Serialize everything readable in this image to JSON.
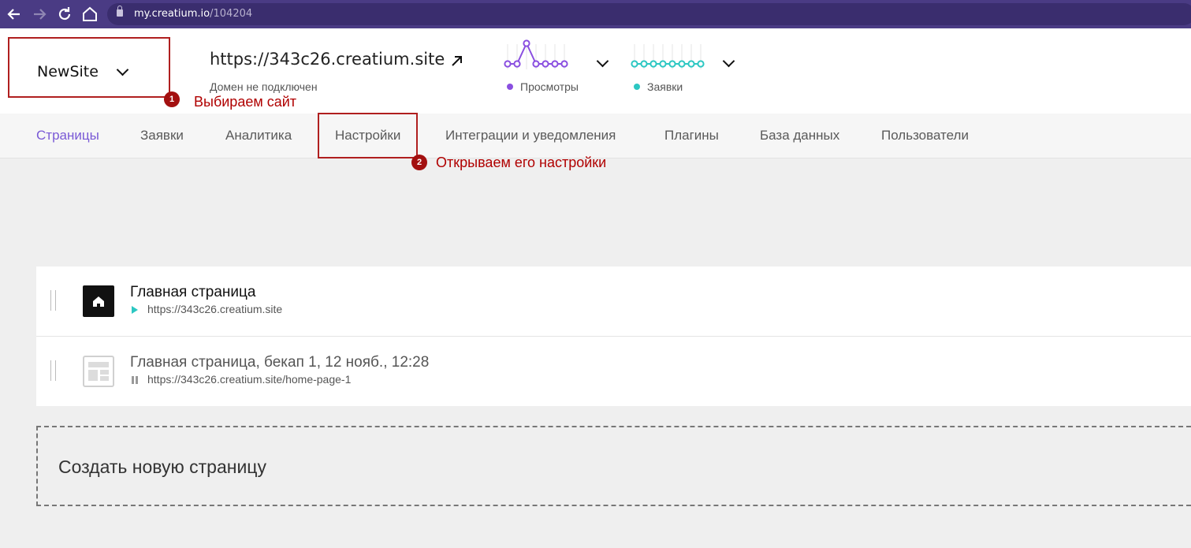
{
  "browser": {
    "url_domain": "my.creatium.io",
    "url_path": "/104204"
  },
  "header": {
    "site_name": "NewSite",
    "site_url": "https://343c26.creatium.site",
    "domain_note": "Домен не подключен",
    "views_label": "Просмотры",
    "requests_label": "Заявки",
    "views_series": [
      0,
      0,
      1,
      0,
      0,
      0,
      0
    ],
    "requests_series": [
      0,
      0,
      0,
      0,
      0,
      0,
      0,
      0
    ],
    "colors": {
      "views": "#8a4fe0",
      "requests": "#2cc7c2",
      "annotation": "#b00000",
      "active_tab": "#7a5ad6"
    }
  },
  "annotations": [
    {
      "number": "1",
      "text": "Выбираем сайт"
    },
    {
      "number": "2",
      "text": "Открываем его настройки"
    }
  ],
  "tabs": [
    {
      "label": "Страницы",
      "active": true
    },
    {
      "label": "Заявки"
    },
    {
      "label": "Аналитика"
    },
    {
      "label": "Настройки"
    },
    {
      "label": "Интеграции и уведомления"
    },
    {
      "label": "Плагины"
    },
    {
      "label": "База данных"
    },
    {
      "label": "Пользователи"
    }
  ],
  "pages": [
    {
      "title": "Главная страница",
      "url": "https://343c26.creatium.site",
      "status": "published",
      "icon": "home-icon"
    },
    {
      "title": "Главная страница, бекап 1, 12 нояб., 12:28",
      "url": "https://343c26.creatium.site/home-page-1",
      "status": "paused",
      "icon": "page-layout-icon"
    }
  ],
  "create_page_label": "Создать новую страницу"
}
